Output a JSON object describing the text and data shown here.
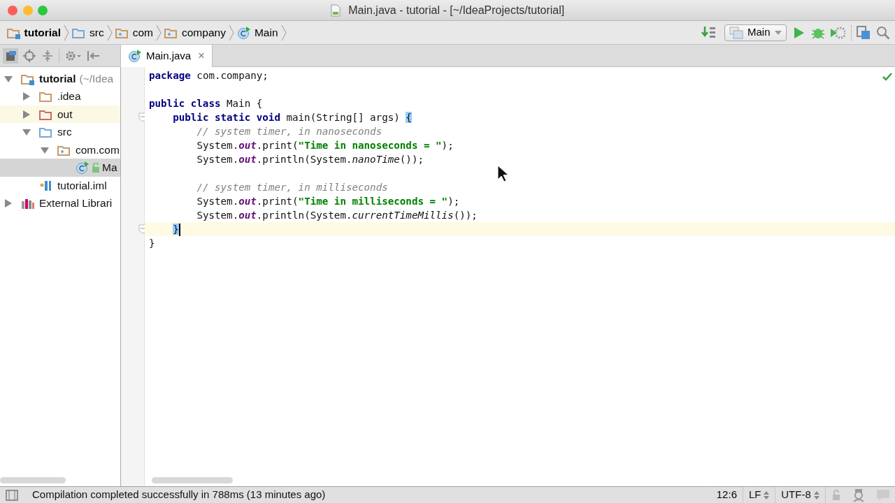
{
  "window": {
    "title": "Main.java - tutorial - [~/IdeaProjects/tutorial]"
  },
  "breadcrumbs": [
    {
      "kind": "module",
      "label": "tutorial"
    },
    {
      "kind": "source-folder",
      "label": "src"
    },
    {
      "kind": "package",
      "label": "com"
    },
    {
      "kind": "package",
      "label": "company"
    },
    {
      "kind": "class",
      "label": "Main"
    }
  ],
  "run_config": {
    "label": "Main"
  },
  "tabs": [
    {
      "label": "Main.java",
      "selected": true,
      "close": "×"
    }
  ],
  "project_tree": [
    {
      "kind": "module",
      "label": "tutorial",
      "hint": "(~/Idea",
      "expanded": true,
      "selected": false,
      "children": [
        {
          "kind": "folder",
          "label": ".idea",
          "expanded": false,
          "selected": false
        },
        {
          "kind": "excluded-folder",
          "label": "out",
          "expanded": false,
          "selected": false
        },
        {
          "kind": "source-folder",
          "label": "src",
          "expanded": true,
          "selected": false,
          "children": [
            {
              "kind": "package",
              "label": "com.com",
              "expanded": true,
              "selected": false,
              "children": [
                {
                  "kind": "class",
                  "label": "Ma",
                  "selected": true
                }
              ]
            }
          ]
        },
        {
          "kind": "file",
          "label": "tutorial.iml",
          "selected": false
        }
      ]
    },
    {
      "kind": "library",
      "label": "External Librari",
      "expanded": false,
      "selected": false
    }
  ],
  "code": [
    {
      "kind": "code",
      "tokens": [
        {
          "kind": "keyword",
          "text": "package"
        },
        {
          "kind": "plain",
          "text": " com.company;"
        }
      ]
    },
    {
      "kind": "blank"
    },
    {
      "kind": "code",
      "tokens": [
        {
          "kind": "keyword",
          "text": "public class"
        },
        {
          "kind": "plain",
          "text": " Main {"
        }
      ],
      "children": [
        {
          "kind": "code",
          "fold": true,
          "tokens": [
            {
              "kind": "keyword",
              "text": "public static void"
            },
            {
              "kind": "plain",
              "text": " main(String[] args) "
            },
            {
              "kind": "brace-match",
              "text": "{"
            }
          ],
          "children": [
            {
              "kind": "code",
              "tokens": [
                {
                  "kind": "comment",
                  "text": "// system timer, in nanoseconds"
                }
              ]
            },
            {
              "kind": "code",
              "tokens": [
                {
                  "kind": "plain",
                  "text": "System."
                },
                {
                  "kind": "field",
                  "text": "out"
                },
                {
                  "kind": "plain",
                  "text": ".print("
                },
                {
                  "kind": "string",
                  "text": "\"Time in nanoseconds = \""
                },
                {
                  "kind": "plain",
                  "text": ");"
                }
              ]
            },
            {
              "kind": "code",
              "tokens": [
                {
                  "kind": "plain",
                  "text": "System."
                },
                {
                  "kind": "field",
                  "text": "out"
                },
                {
                  "kind": "plain",
                  "text": ".println(System."
                },
                {
                  "kind": "static-call",
                  "text": "nanoTime"
                },
                {
                  "kind": "plain",
                  "text": "());"
                }
              ]
            },
            {
              "kind": "blank"
            },
            {
              "kind": "code",
              "tokens": [
                {
                  "kind": "comment",
                  "text": "// system timer, in milliseconds"
                }
              ]
            },
            {
              "kind": "code",
              "tokens": [
                {
                  "kind": "plain",
                  "text": "System."
                },
                {
                  "kind": "field",
                  "text": "out"
                },
                {
                  "kind": "plain",
                  "text": ".print("
                },
                {
                  "kind": "string",
                  "text": "\"Time in milliseconds = \""
                },
                {
                  "kind": "plain",
                  "text": ");"
                }
              ]
            },
            {
              "kind": "code",
              "tokens": [
                {
                  "kind": "plain",
                  "text": "System."
                },
                {
                  "kind": "field",
                  "text": "out"
                },
                {
                  "kind": "plain",
                  "text": ".println(System."
                },
                {
                  "kind": "static-call",
                  "text": "currentTimeMillis"
                },
                {
                  "kind": "plain",
                  "text": "());"
                }
              ]
            }
          ]
        },
        {
          "kind": "code",
          "fold": true,
          "current": true,
          "tokens": [
            {
              "kind": "brace-match",
              "text": "}"
            }
          ]
        }
      ]
    },
    {
      "kind": "code",
      "tokens": [
        {
          "kind": "plain",
          "text": "}"
        }
      ]
    }
  ],
  "status_bar": {
    "message": "Compilation completed successfully in 788ms (13 minutes ago)",
    "position": "12:6",
    "line_separator": "LF",
    "encoding": "UTF-8"
  }
}
